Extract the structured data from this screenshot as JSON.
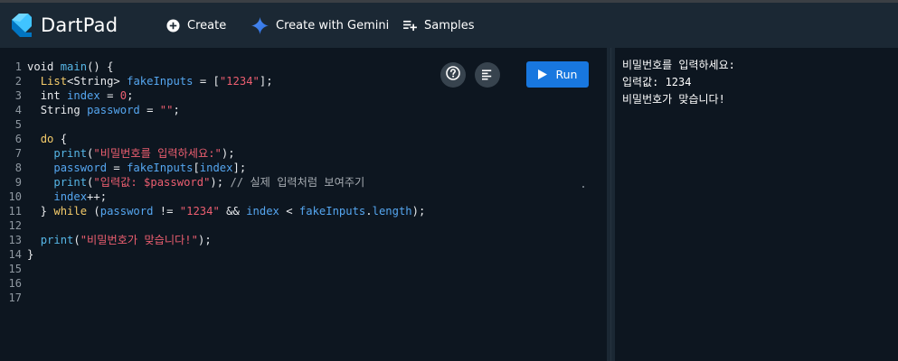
{
  "app": {
    "title": "DartPad"
  },
  "nav": {
    "create": "Create",
    "gemini": "Create with Gemini",
    "samples": "Samples"
  },
  "editor": {
    "run_label": "Run",
    "line_numbers": [
      "1",
      "2",
      "3",
      "4",
      "5",
      "6",
      "7",
      "8",
      "9",
      "10",
      "11",
      "12",
      "13",
      "14",
      "15",
      "16",
      "17"
    ],
    "code": {
      "void": "void",
      "main": "main",
      "list": "List",
      "string_type": "String",
      "fake_inputs": "fakeInputs",
      "str_1234": "\"1234\"",
      "int_kw": "int",
      "index": "index",
      "zero": "0",
      "password": "password",
      "empty_str": "\"\"",
      "do_kw": "do",
      "print": "print",
      "prompt_str": "\"비밀번호를 입력하세요:\"",
      "input_str": "\"입력값: $password\"",
      "comment": "// 실제 입력처럼 보여주기",
      "while_kw": "while",
      "length": "length",
      "success_str": "\"비밀번호가 맞습니다!\""
    }
  },
  "output": {
    "lines": [
      "비밀번호를 입력하세요:",
      "입력값: 1234",
      "비밀번호가 맞습니다!"
    ]
  },
  "colors": {
    "run_button": "#1877df",
    "editor_bg": "#0d1620",
    "header_bg": "#1b2834"
  }
}
